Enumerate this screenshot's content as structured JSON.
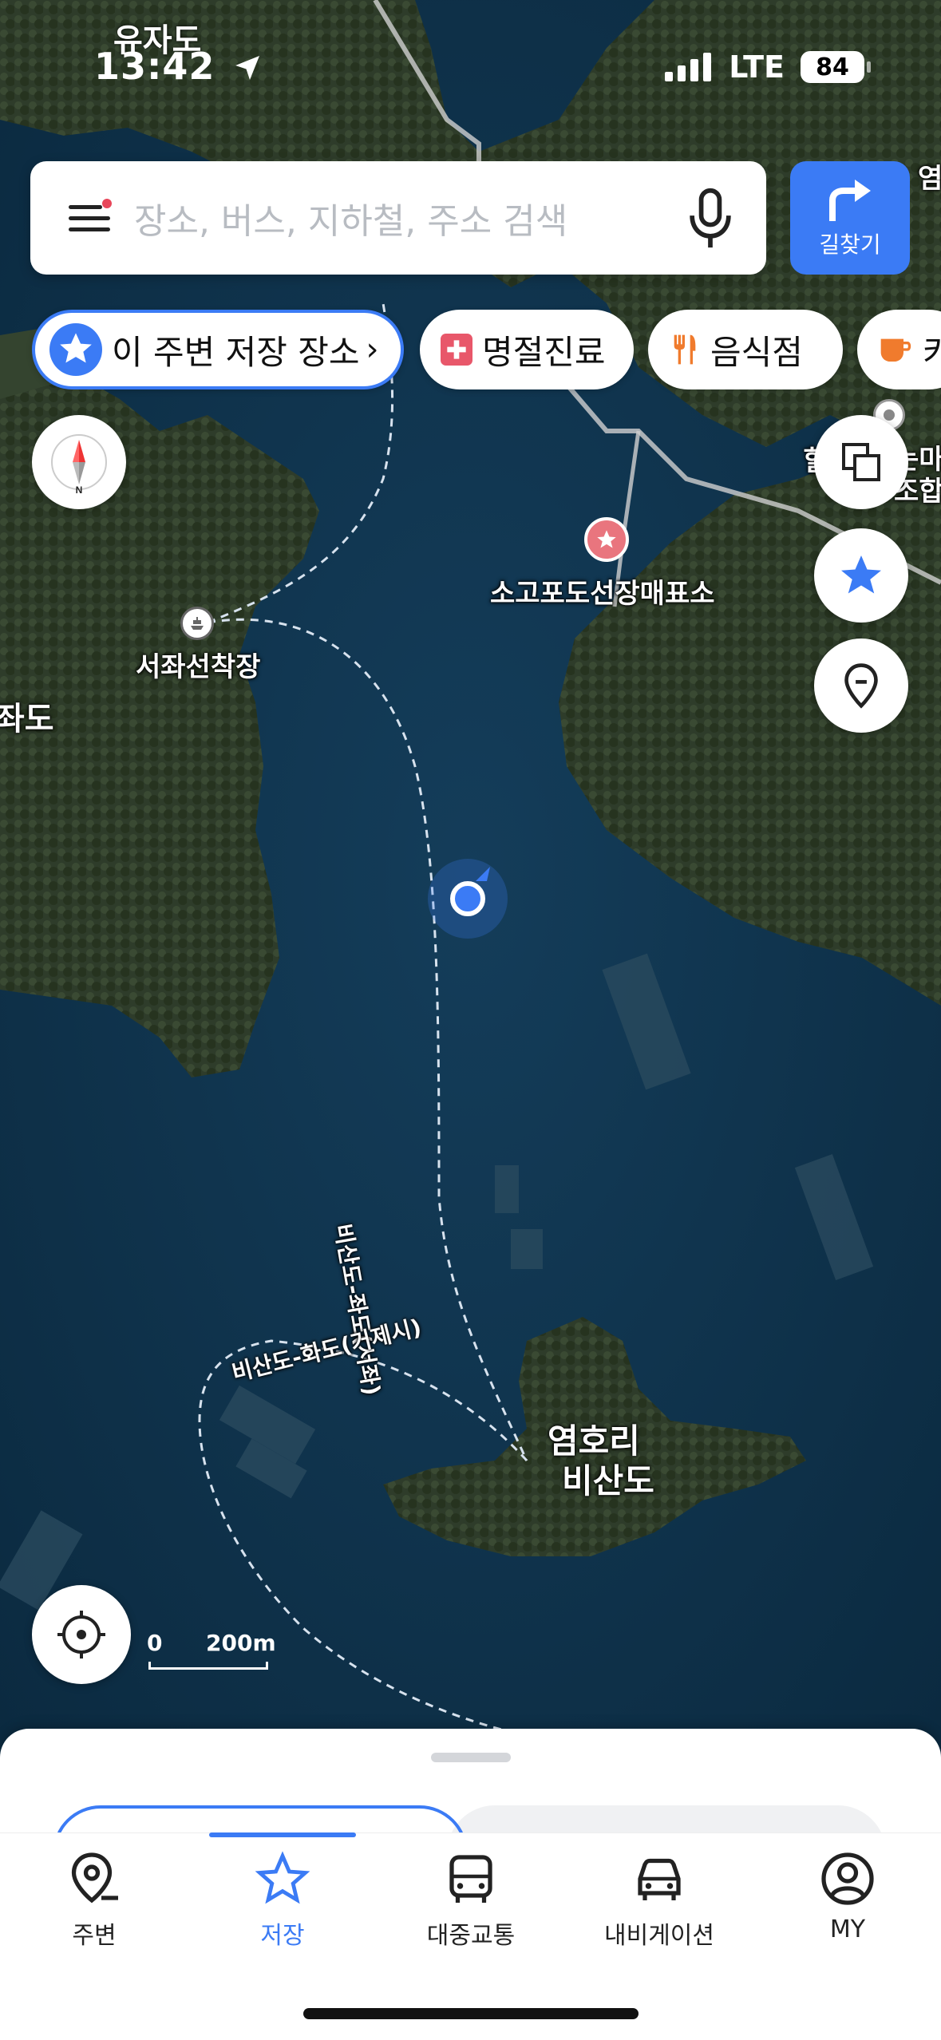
{
  "status_bar": {
    "time": "13:42",
    "location_name": "유자도",
    "network": "LTE",
    "battery": "84"
  },
  "search": {
    "placeholder": "장소, 버스, 지하철, 주소 검색"
  },
  "directions": {
    "label": "길찾기"
  },
  "chips": [
    {
      "label": "이 주변 저장 장소",
      "icon": "star-icon"
    },
    {
      "label": "명절진료",
      "icon": "medical-cross-icon"
    },
    {
      "label": "음식점",
      "icon": "fork-knife-icon"
    },
    {
      "label": "카",
      "icon": "coffee-cup-icon"
    }
  ],
  "map": {
    "labels": {
      "seojwa_dock": "서좌선착장",
      "jwado": "좌도",
      "sogopo": "소고포도선장매표소",
      "yeomhori": "염호리",
      "bisando": "비산도",
      "route_jwado": "비산도-좌도(서좌)",
      "route_hwado": "비산도-화도(거제시)",
      "edge_top_right": "염",
      "edge_right_1": "는마",
      "edge_right_2": "조합",
      "edge_right_3": "힐"
    },
    "scale": {
      "zero": "0",
      "distance": "200m"
    },
    "colors": {
      "water": "#0f3550",
      "land": "#2d3b2a",
      "accent": "#3b7bf5"
    }
  },
  "tabbar": {
    "active": "저장",
    "items": [
      {
        "label": "주변",
        "icon": "nearby-pin-icon"
      },
      {
        "label": "저장",
        "icon": "star-icon"
      },
      {
        "label": "대중교통",
        "icon": "bus-icon"
      },
      {
        "label": "내비게이션",
        "icon": "car-icon"
      },
      {
        "label": "MY",
        "icon": "profile-icon"
      }
    ]
  }
}
